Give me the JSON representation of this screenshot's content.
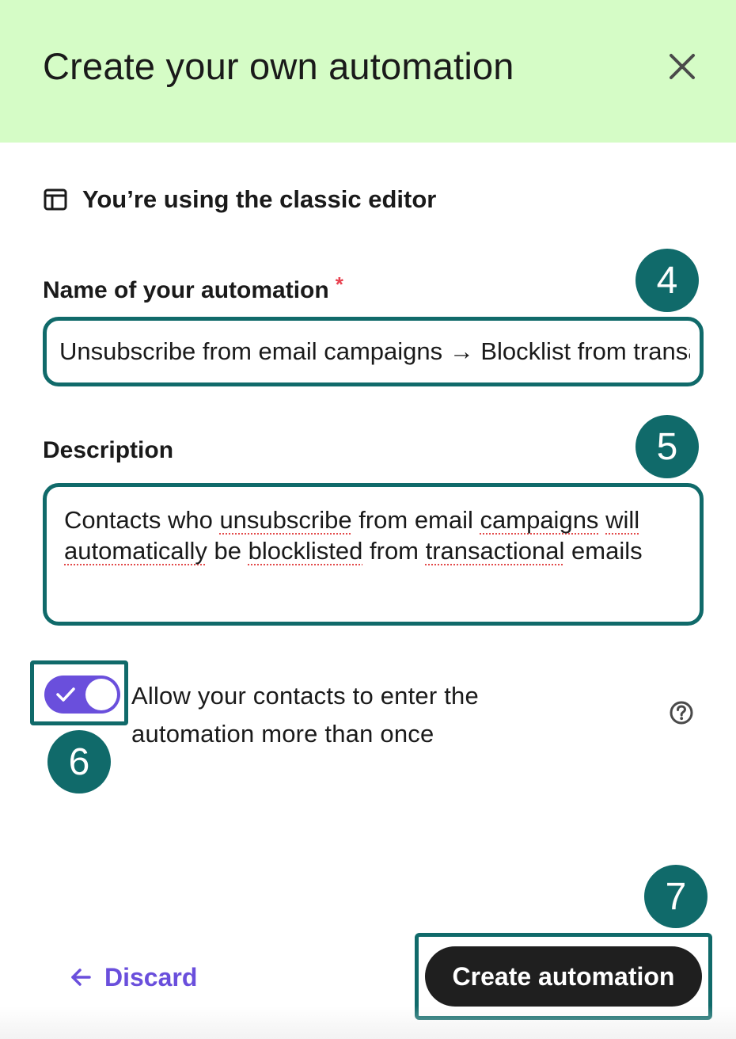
{
  "header": {
    "title": "Create your own automation",
    "close_icon": "close-icon"
  },
  "editor_note": {
    "icon": "layout-icon",
    "text": "You’re using the classic editor"
  },
  "name_field": {
    "label": "Name of your automation",
    "required_mark": "*",
    "value": "Unsubscribe from email campaigns → Blocklist from transactional emails",
    "step": "4"
  },
  "description_field": {
    "label": "Description",
    "value_parts": [
      "Contacts who ",
      "unsubscribe",
      " from email ",
      "campaigns",
      " ",
      "will automatically",
      " be ",
      "blocklisted",
      " from ",
      "transactional",
      " emails"
    ],
    "step": "5"
  },
  "reentry_toggle": {
    "checked": true,
    "label": "Allow your contacts to enter the automation more than once",
    "help_icon": "help-circle-icon",
    "step": "6"
  },
  "footer": {
    "discard_label": "Discard",
    "create_label": "Create automation",
    "step": "7"
  },
  "colors": {
    "header_bg": "#d5fcc6",
    "annotation_teal": "#106a6a",
    "accent_purple": "#6a4fdc",
    "required_red": "#e8414f",
    "button_dark": "#1f1f1f"
  }
}
